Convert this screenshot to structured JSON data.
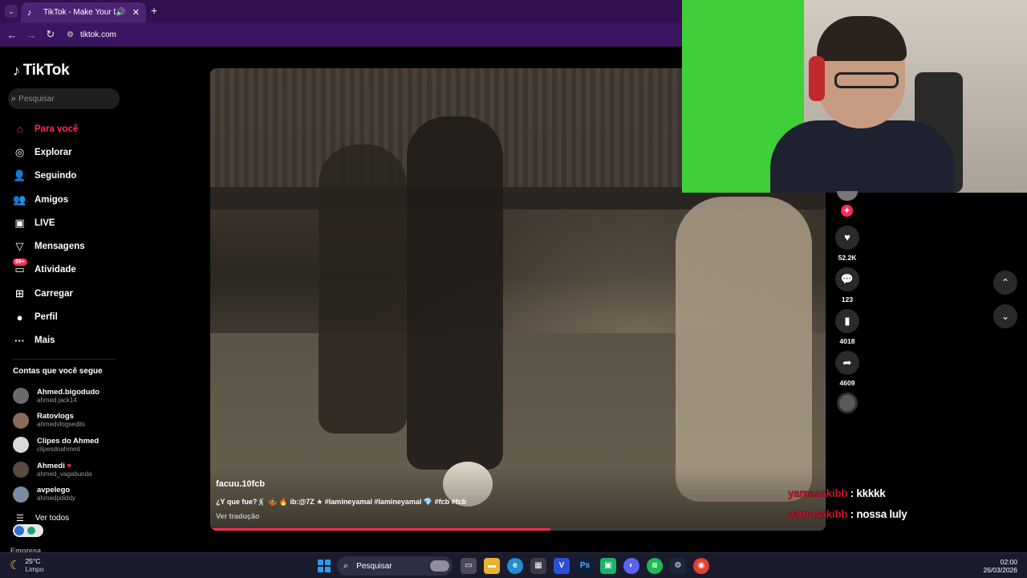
{
  "browser": {
    "tab_title": "TikTok - Make Your Day",
    "url": "tiktok.com"
  },
  "sidebar": {
    "logo_text": "TikTok",
    "search_placeholder": "Pesquisar",
    "menu": [
      {
        "label": "Para você",
        "icon": "home-icon"
      },
      {
        "label": "Explorar",
        "icon": "compass-icon"
      },
      {
        "label": "Seguindo",
        "icon": "user-follow-icon"
      },
      {
        "label": "Amigos",
        "icon": "friends-icon"
      },
      {
        "label": "LIVE",
        "icon": "live-icon"
      },
      {
        "label": "Mensagens",
        "icon": "send-icon"
      },
      {
        "label": "Atividade",
        "icon": "activity-icon",
        "badge": "99+"
      },
      {
        "label": "Carregar",
        "icon": "upload-icon"
      },
      {
        "label": "Perfil",
        "icon": "profile-avatar-icon"
      },
      {
        "label": "Mais",
        "icon": "more-icon"
      }
    ],
    "following_header": "Contas que você segue",
    "accounts": [
      {
        "name": "Ahmed.bigodudo",
        "handle": "ahmed.jack14",
        "heart": false
      },
      {
        "name": "Ratovlogs",
        "handle": "ahmedvlogsedits",
        "heart": false
      },
      {
        "name": "Clipes do Ahmed",
        "handle": "clipesdoahmed",
        "heart": false
      },
      {
        "name": "Ahmedi",
        "handle": "ahmed_vagabunda",
        "heart": true
      },
      {
        "name": "avpelego",
        "handle": "ahmedpdiddy",
        "heart": false
      }
    ],
    "see_all": "Ver todos",
    "company": "Empresa"
  },
  "video": {
    "author": "facuu.10fcb",
    "caption": "¿Y que fue?🕺 🤹 🔥 ib:@7Z ★ #lamineyamal #lamineyamal 💎 #fcb #fcb",
    "translate": "Ver tradução",
    "progress": 0.553
  },
  "actions": {
    "likes": "52.2K",
    "comments": "123",
    "saves": "4018",
    "shares": "4609"
  },
  "chat": [
    {
      "user": "yamasakibb",
      "message": ": kkkkk"
    },
    {
      "user": "yamasakibb",
      "message": ": nossa luly"
    }
  ],
  "taskbar": {
    "temp": "25°C",
    "weather": "Limpo",
    "search": "Pesquisar",
    "time": "02:00",
    "date": "26/03/2026"
  },
  "colors": {
    "accent": "#fe2c55",
    "browser_frame": "#3b1561",
    "chat_user": "#e6132c"
  }
}
